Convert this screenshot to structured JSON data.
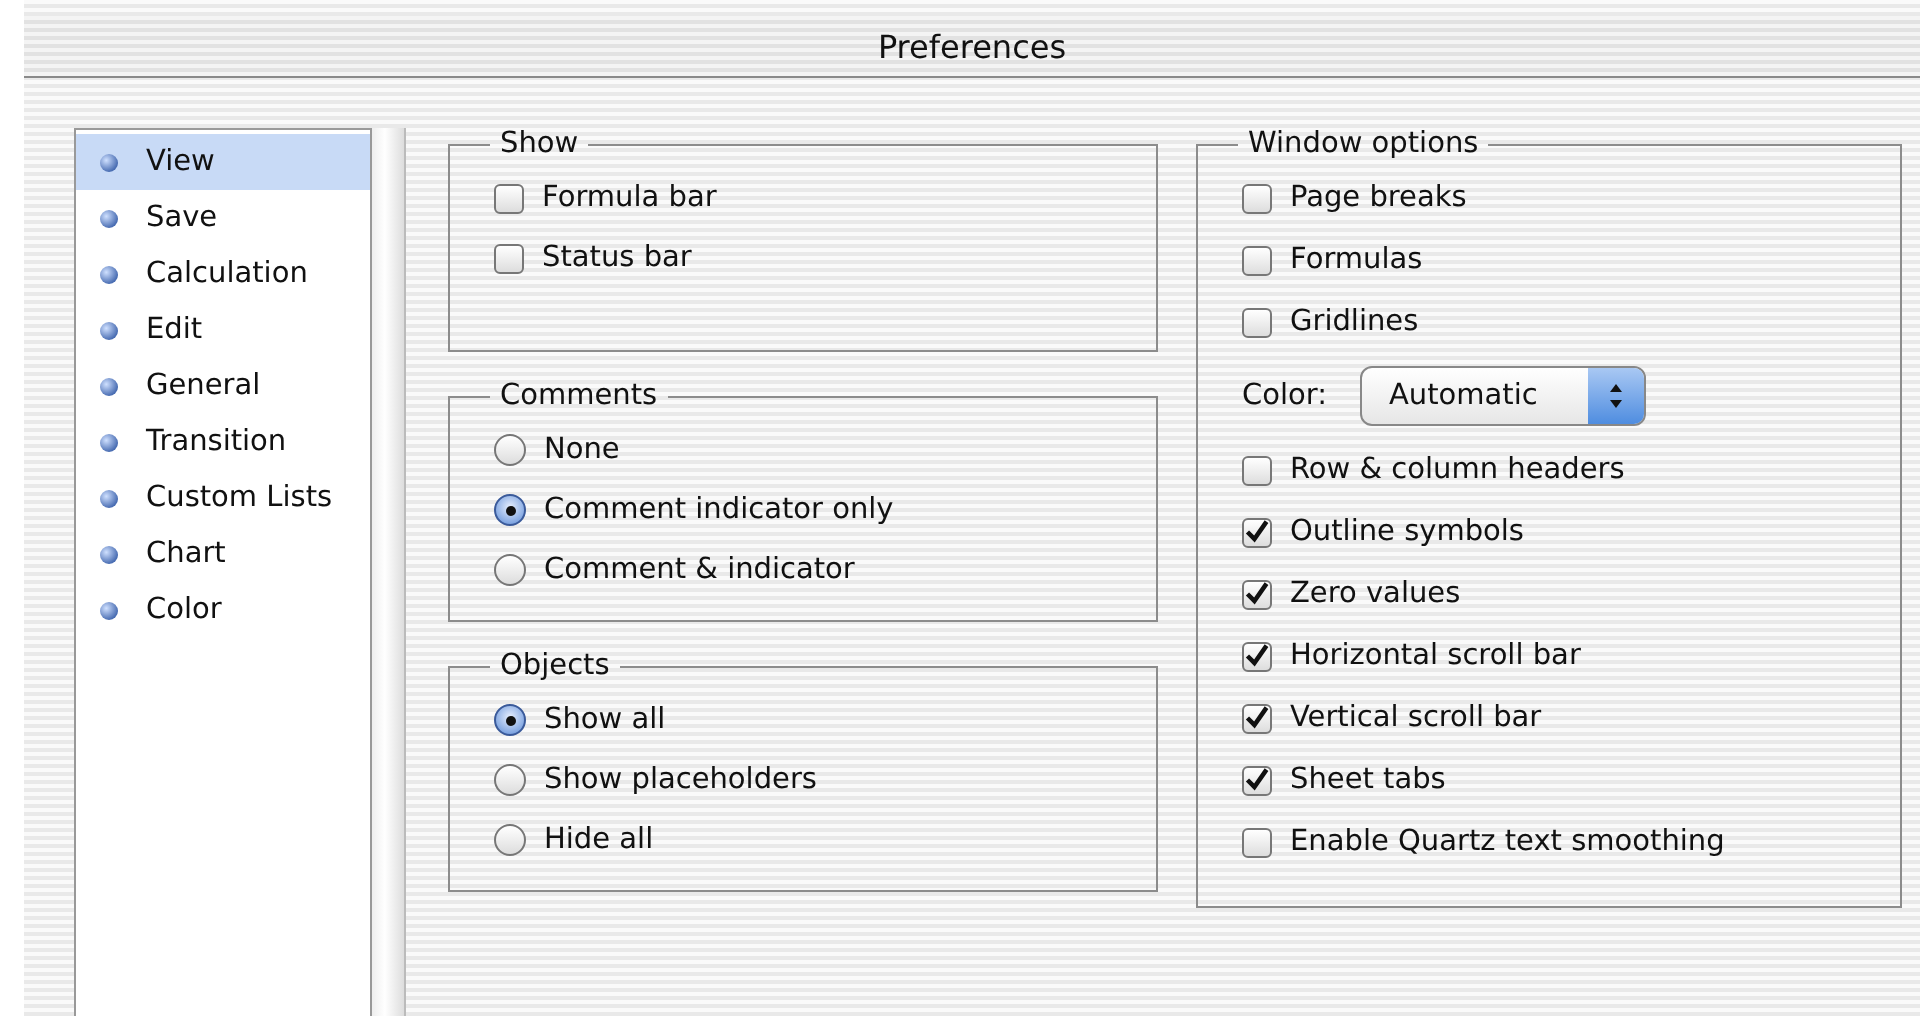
{
  "window": {
    "title": "Preferences"
  },
  "sidebar": {
    "items": [
      {
        "label": "View",
        "selected": true
      },
      {
        "label": "Save",
        "selected": false
      },
      {
        "label": "Calculation",
        "selected": false
      },
      {
        "label": "Edit",
        "selected": false
      },
      {
        "label": "General",
        "selected": false
      },
      {
        "label": "Transition",
        "selected": false
      },
      {
        "label": "Custom Lists",
        "selected": false
      },
      {
        "label": "Chart",
        "selected": false
      },
      {
        "label": "Color",
        "selected": false
      }
    ]
  },
  "groups": [
    {
      "title": "Show",
      "items": [
        {
          "kind": "checkbox",
          "label": "Formula bar",
          "checked": false
        },
        {
          "kind": "checkbox",
          "label": "Status bar",
          "checked": false
        }
      ]
    },
    {
      "title": "Comments",
      "items": [
        {
          "kind": "radio",
          "label": "None",
          "selected": false
        },
        {
          "kind": "radio",
          "label": "Comment indicator only",
          "selected": true
        },
        {
          "kind": "radio",
          "label": "Comment & indicator",
          "selected": false
        }
      ]
    },
    {
      "title": "Objects",
      "items": [
        {
          "kind": "radio",
          "label": "Show all",
          "selected": true
        },
        {
          "kind": "radio",
          "label": "Show placeholders",
          "selected": false
        },
        {
          "kind": "radio",
          "label": "Hide all",
          "selected": false
        }
      ]
    }
  ],
  "window_options": {
    "title": "Window options",
    "items": [
      {
        "kind": "checkbox",
        "label": "Page breaks",
        "checked": false
      },
      {
        "kind": "checkbox",
        "label": "Formulas",
        "checked": false
      },
      {
        "kind": "checkbox",
        "label": "Gridlines",
        "checked": false
      },
      {
        "kind": "popup",
        "label": "Color:",
        "value": "Automatic"
      },
      {
        "kind": "checkbox",
        "label": "Row & column headers",
        "checked": false
      },
      {
        "kind": "checkbox",
        "label": "Outline symbols",
        "checked": true
      },
      {
        "kind": "checkbox",
        "label": "Zero values",
        "checked": true
      },
      {
        "kind": "checkbox",
        "label": "Horizontal scroll bar",
        "checked": true
      },
      {
        "kind": "checkbox",
        "label": "Vertical scroll bar",
        "checked": true
      },
      {
        "kind": "checkbox",
        "label": "Sheet tabs",
        "checked": true
      },
      {
        "kind": "checkbox",
        "label": "Enable Quartz text smoothing",
        "checked": false
      }
    ]
  }
}
